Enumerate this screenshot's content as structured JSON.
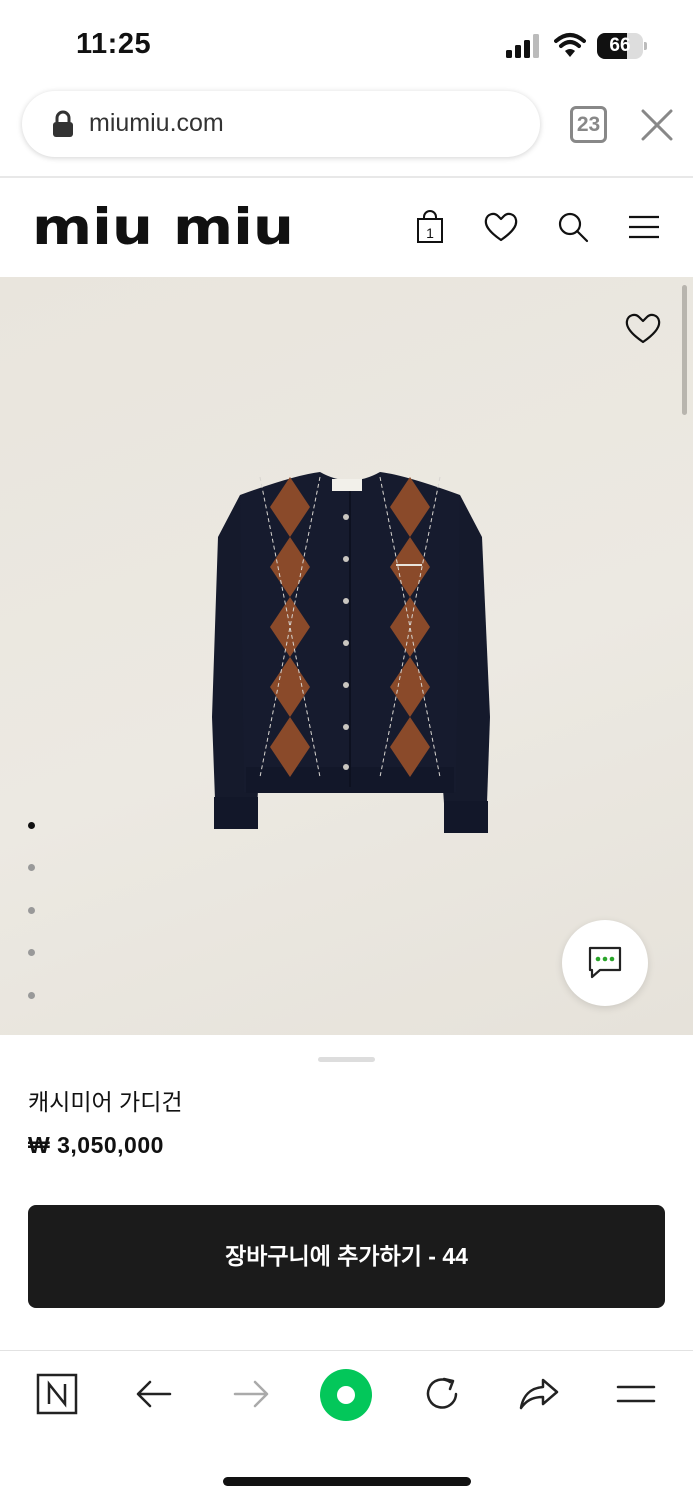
{
  "status_bar": {
    "time": "11:25",
    "battery_level": "66",
    "battery_fraction": 0.66
  },
  "browser": {
    "url": "miumiu.com",
    "tab_count": "23",
    "icons": [
      "lock-icon",
      "close-icon"
    ]
  },
  "site_header": {
    "brand": "miu miu",
    "cart_count": "1",
    "icons": [
      "shopping-bag-icon",
      "heart-icon",
      "search-icon",
      "hamburger-menu-icon"
    ]
  },
  "product": {
    "image_alt": "navy argyle cashmere cardigan",
    "name": "캐시미어 가디건",
    "price": "₩ 3,050,000",
    "add_to_cart_label": "장바구니에 추가하기 - 44",
    "gallery": {
      "total_images": 5,
      "active_index": 0
    },
    "icons": [
      "heart-icon",
      "chat-icon"
    ]
  },
  "colors": {
    "button_bg": "#1b1b1b",
    "hero_bg": "#e9e5dd",
    "chat_accent": "#2aa52a",
    "browser_home_accent": "#03c75a"
  },
  "browser_toolbar": {
    "items": [
      "naver-icon",
      "back-icon",
      "forward-icon",
      "home-icon",
      "reload-icon",
      "share-icon",
      "menu-icon"
    ],
    "forward_disabled": true
  }
}
